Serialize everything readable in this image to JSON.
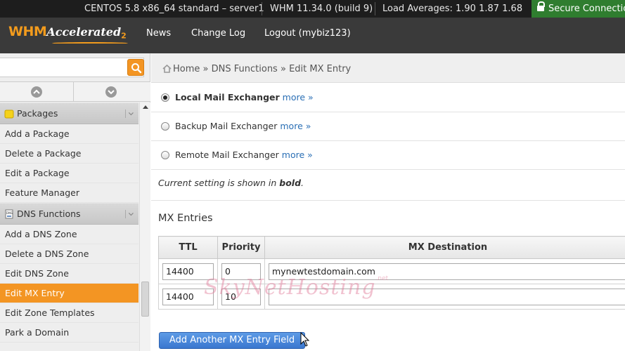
{
  "status_bar": {
    "server_info": "CENTOS 5.8 x86_64 standard – server1",
    "version": "WHM 11.34.0 (build 9)",
    "load_averages": "Load Averages: 1.90 1.87 1.68",
    "secure": "Secure Connection"
  },
  "header": {
    "logo_whm": "WHM",
    "logo_accelerated": "Accelerated",
    "logo_version": "2",
    "nav": [
      "News",
      "Change Log",
      "Logout (mybiz123)"
    ]
  },
  "sidebar": {
    "search_placeholder": "",
    "categories": [
      {
        "label": "Packages",
        "icon": "package-icon",
        "items": [
          "Add a Package",
          "Delete a Package",
          "Edit a Package",
          "Feature Manager"
        ]
      },
      {
        "label": "DNS Functions",
        "icon": "dns-icon",
        "items": [
          "Add a DNS Zone",
          "Delete a DNS Zone",
          "Edit DNS Zone",
          "Edit MX Entry",
          "Edit Zone Templates",
          "Park a Domain"
        ]
      }
    ],
    "active_item": "Edit MX Entry"
  },
  "breadcrumb": {
    "home": "Home",
    "separator": "»",
    "section": "DNS Functions",
    "current": "Edit MX Entry"
  },
  "main": {
    "options": [
      {
        "label": "Local Mail Exchanger",
        "more": "more »",
        "checked": true
      },
      {
        "label": "Backup Mail Exchanger",
        "more": "more »",
        "checked": false
      },
      {
        "label": "Remote Mail Exchanger",
        "more": "more »",
        "checked": false
      }
    ],
    "note_prefix": "Current setting is shown in ",
    "note_bold": "bold",
    "note_suffix": ".",
    "mx_title": "MX Entries",
    "table": {
      "headers": [
        "TTL",
        "Priority",
        "MX Destination"
      ],
      "rows": [
        {
          "ttl": "14400",
          "priority": "0",
          "destination": "mynewtestdomain.com"
        },
        {
          "ttl": "14400",
          "priority": "10",
          "destination": ""
        }
      ]
    },
    "add_button": "Add Another MX Entry Field"
  },
  "watermark": {
    "text": "SkyNetHosting",
    "suffix": ".net"
  },
  "colors": {
    "accent": "#f39523",
    "link": "#2a6fb5",
    "button": "#4a88da",
    "secure": "#2f7d2f"
  }
}
